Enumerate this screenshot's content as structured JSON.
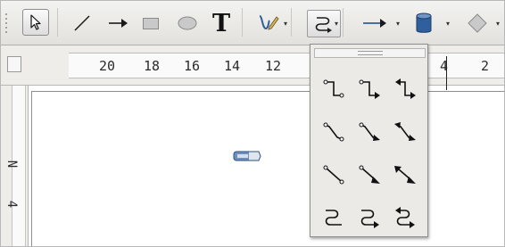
{
  "toolbar": {
    "tools": [
      {
        "name": "select-tool",
        "icon": "pointer-arrow-icon"
      },
      {
        "name": "line-tool",
        "icon": "line-icon"
      },
      {
        "name": "arrow-line-tool",
        "icon": "arrow-line-icon"
      },
      {
        "name": "rectangle-tool",
        "icon": "rectangle-icon"
      },
      {
        "name": "ellipse-tool",
        "icon": "ellipse-icon"
      },
      {
        "name": "text-tool",
        "icon": "text-icon"
      },
      {
        "name": "curve-tool",
        "icon": "curve-pen-icon"
      },
      {
        "name": "connector-tool",
        "icon": "connector-icon"
      },
      {
        "name": "lines-arrows-tool",
        "icon": "arrow-line-icon"
      },
      {
        "name": "3d-objects-tool",
        "icon": "cylinder-icon"
      },
      {
        "name": "basic-shapes-tool",
        "icon": "diamond-icon"
      }
    ],
    "text_tool_label": "T",
    "dropdown_glyph": "▾"
  },
  "ruler": {
    "horizontal_labels": [
      "20",
      "18",
      "16",
      "14",
      "12",
      "4",
      "2"
    ],
    "vertical_labels": [
      "N",
      "4"
    ]
  },
  "connector_popup": {
    "rows": [
      [
        "standard-connector-icon",
        "standard-connector-arrow-end-icon",
        "standard-connector-arrows-icon"
      ],
      [
        "line-connector-icon",
        "line-connector-arrow-end-icon",
        "line-connector-arrows-icon"
      ],
      [
        "straight-connector-icon",
        "straight-connector-arrow-end-icon",
        "straight-connector-arrows-icon"
      ],
      [
        "curved-connector-icon",
        "curved-connector-arrow-end-icon",
        "curved-connector-arrows-icon"
      ]
    ]
  },
  "colors": {
    "toolbar_bg": "#e9e8e4",
    "fill_blue": "#2f5f9c",
    "icon_dark": "#1a1a1a"
  }
}
